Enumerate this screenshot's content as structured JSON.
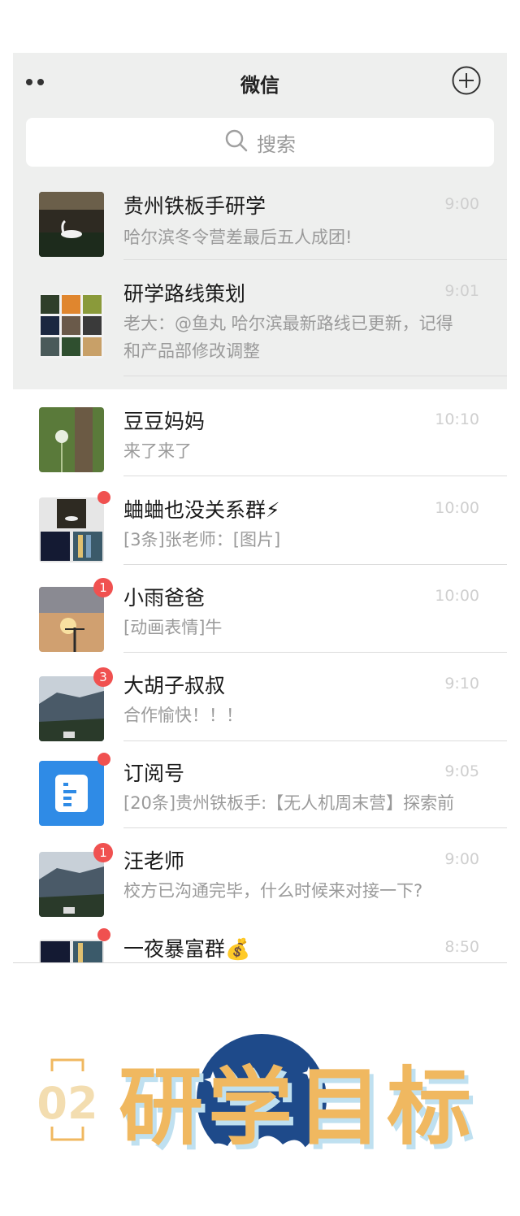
{
  "nav": {
    "title": "微信"
  },
  "search": {
    "placeholder": "搜索"
  },
  "pinned": [
    {
      "name": "贵州铁板手研学",
      "time": "9:00",
      "msg": "哈尔滨冬令营差最后五人成团!"
    },
    {
      "name": "研学路线策划",
      "time": "9:01",
      "msg_line1": "老大：@鱼丸  哈尔滨最新路线已更新，记得",
      "msg_line2": "和产品部修改调整"
    }
  ],
  "chats": [
    {
      "name": "豆豆妈妈",
      "time": "10:10",
      "msg": "来了来了"
    },
    {
      "name": "蛐蛐也没关系群⚡",
      "time": "10:00",
      "msg": "[3条]张老师：[图片]"
    },
    {
      "name": "小雨爸爸",
      "time": "10:00",
      "msg": "[动画表情]牛",
      "badge": "1"
    },
    {
      "name": "大胡子叔叔",
      "time": "9:10",
      "msg": "合作愉快！！！",
      "badge": "3"
    },
    {
      "name": "订阅号",
      "time": "9:05",
      "msg": "[20条]贵州铁板手:【无人机周末营】探索前"
    },
    {
      "name": "汪老师",
      "time": "9:00",
      "msg": "校方已沟通完毕，什么时候来对接一下?",
      "badge": "1"
    },
    {
      "name": "一夜暴富群💰",
      "time": "8:50"
    }
  ],
  "banner": {
    "number": "02",
    "title": "研学目标"
  },
  "colors": {
    "badge": "#f05150",
    "pinned_bg": "#eeefee",
    "banner_text": "#f0b860",
    "banner_number": "#f3ddb0",
    "banner_circle": "#1e4a8a"
  }
}
